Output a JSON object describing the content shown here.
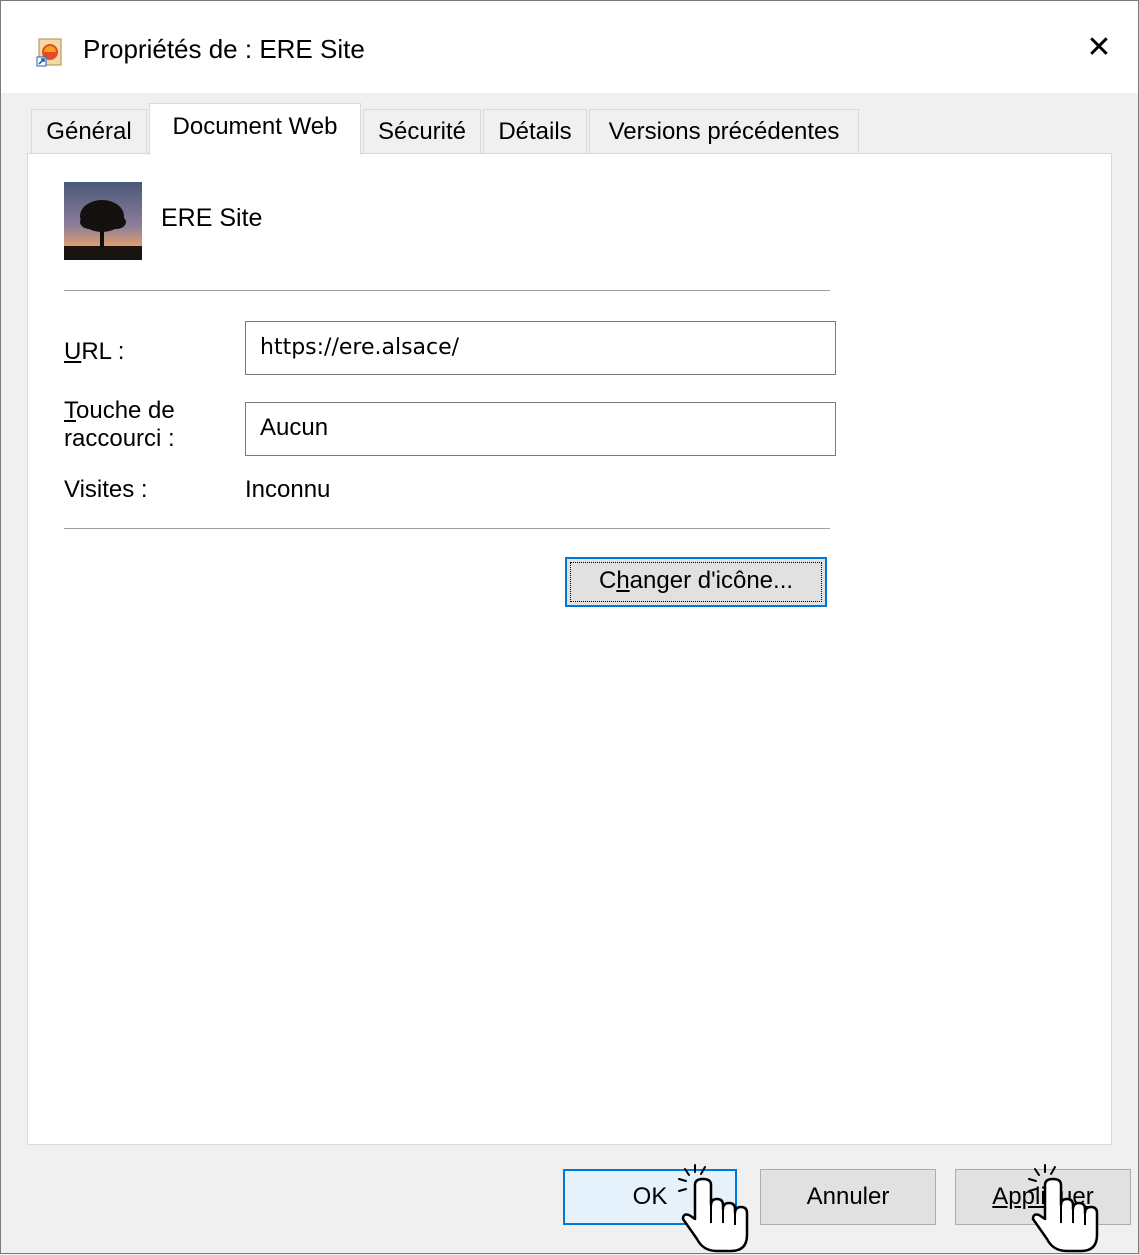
{
  "window": {
    "title": "Propriétés de : ERE Site",
    "close_symbol": "✕",
    "title_icon": "internet-shortcut-icon"
  },
  "tabs": [
    {
      "label": "Général",
      "active": false
    },
    {
      "label": "Document Web",
      "active": true
    },
    {
      "label": "Sécurité",
      "active": false
    },
    {
      "label": "Détails",
      "active": false
    },
    {
      "label": "Versions précédentes",
      "active": false
    }
  ],
  "shortcut": {
    "name": "ERE Site",
    "thumbnail_icon": "tree-sunset-thumbnail"
  },
  "form": {
    "url_label_mn": "U",
    "url_label_rest": "RL :",
    "url_value": "https://ere.alsace/",
    "hotkey_label_mn": "T",
    "hotkey_label_line1_rest": "ouche de",
    "hotkey_label_line2": "raccourci :",
    "hotkey_value": "Aucun",
    "visits_label": "Visites :",
    "visits_value": "Inconnu",
    "change_icon_pre": "C",
    "change_icon_mn": "h",
    "change_icon_post": "anger d'icône..."
  },
  "footer": {
    "ok_label": "OK",
    "cancel_label": "Annuler",
    "apply_label": "Appliquer"
  },
  "colors": {
    "accent": "#0078d7",
    "panel": "#ffffff",
    "dialog_bg": "#f0f0f0",
    "button_bg": "#e1e1e1"
  }
}
